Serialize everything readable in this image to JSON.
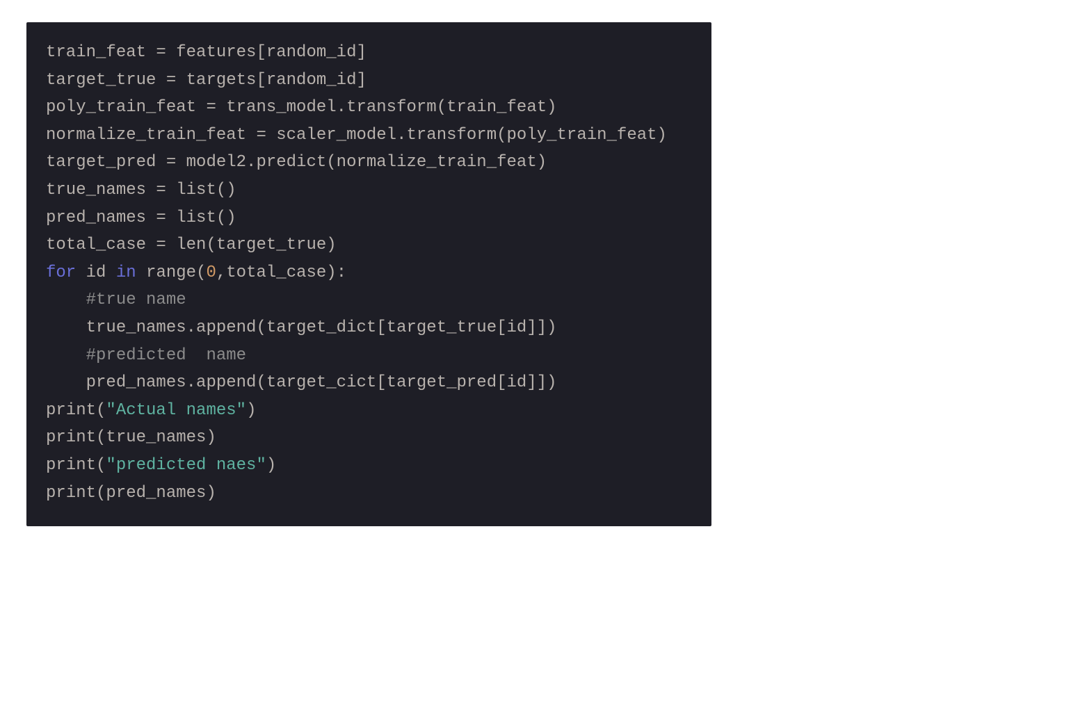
{
  "code": {
    "lines": [
      {
        "indent": 0,
        "tokens": [
          {
            "t": "train_feat = features[random_id]",
            "c": "tok-default"
          }
        ]
      },
      {
        "indent": 0,
        "tokens": [
          {
            "t": "target_true = targets[random_id]",
            "c": "tok-default"
          }
        ]
      },
      {
        "indent": 0,
        "tokens": [
          {
            "t": "poly_train_feat = trans_model.transform(train_feat)",
            "c": "tok-default"
          }
        ]
      },
      {
        "indent": 0,
        "tokens": [
          {
            "t": "normalize_train_feat = scaler_model.transform(poly_train_feat)",
            "c": "tok-default"
          }
        ]
      },
      {
        "indent": 0,
        "tokens": [
          {
            "t": "target_pred = model2.predict(normalize_train_feat)",
            "c": "tok-default"
          }
        ]
      },
      {
        "indent": 0,
        "tokens": [
          {
            "t": "true_names = list()",
            "c": "tok-default"
          }
        ]
      },
      {
        "indent": 0,
        "tokens": [
          {
            "t": "pred_names = list()",
            "c": "tok-default"
          }
        ]
      },
      {
        "indent": 0,
        "tokens": [
          {
            "t": "total_case = len(target_true)",
            "c": "tok-default"
          }
        ]
      },
      {
        "indent": 0,
        "tokens": [
          {
            "t": "for",
            "c": "tok-keyword"
          },
          {
            "t": " id ",
            "c": "tok-default"
          },
          {
            "t": "in",
            "c": "tok-keyword2"
          },
          {
            "t": " range(",
            "c": "tok-default"
          },
          {
            "t": "0",
            "c": "tok-number"
          },
          {
            "t": ",total_case):",
            "c": "tok-default"
          }
        ]
      },
      {
        "indent": 1,
        "tokens": [
          {
            "t": "#true name",
            "c": "tok-comment"
          }
        ]
      },
      {
        "indent": 1,
        "tokens": [
          {
            "t": "true_names.append(target_dict[target_true[id]])",
            "c": "tok-default"
          }
        ]
      },
      {
        "indent": 1,
        "tokens": [
          {
            "t": "#predicted  name",
            "c": "tok-comment"
          }
        ]
      },
      {
        "indent": 1,
        "tokens": [
          {
            "t": "pred_names.append(target_cict[target_pred[id]])",
            "c": "tok-default"
          }
        ]
      },
      {
        "indent": 0,
        "tokens": [
          {
            "t": "print(",
            "c": "tok-default"
          },
          {
            "t": "\"Actual names\"",
            "c": "tok-string"
          },
          {
            "t": ")",
            "c": "tok-default"
          }
        ]
      },
      {
        "indent": 0,
        "tokens": [
          {
            "t": "print(true_names)",
            "c": "tok-default"
          }
        ]
      },
      {
        "indent": 0,
        "tokens": [
          {
            "t": "print(",
            "c": "tok-default"
          },
          {
            "t": "\"predicted naes\"",
            "c": "tok-string"
          },
          {
            "t": ")",
            "c": "tok-default"
          }
        ]
      },
      {
        "indent": 0,
        "tokens": [
          {
            "t": "print(pred_names)",
            "c": "tok-default"
          }
        ]
      }
    ]
  }
}
